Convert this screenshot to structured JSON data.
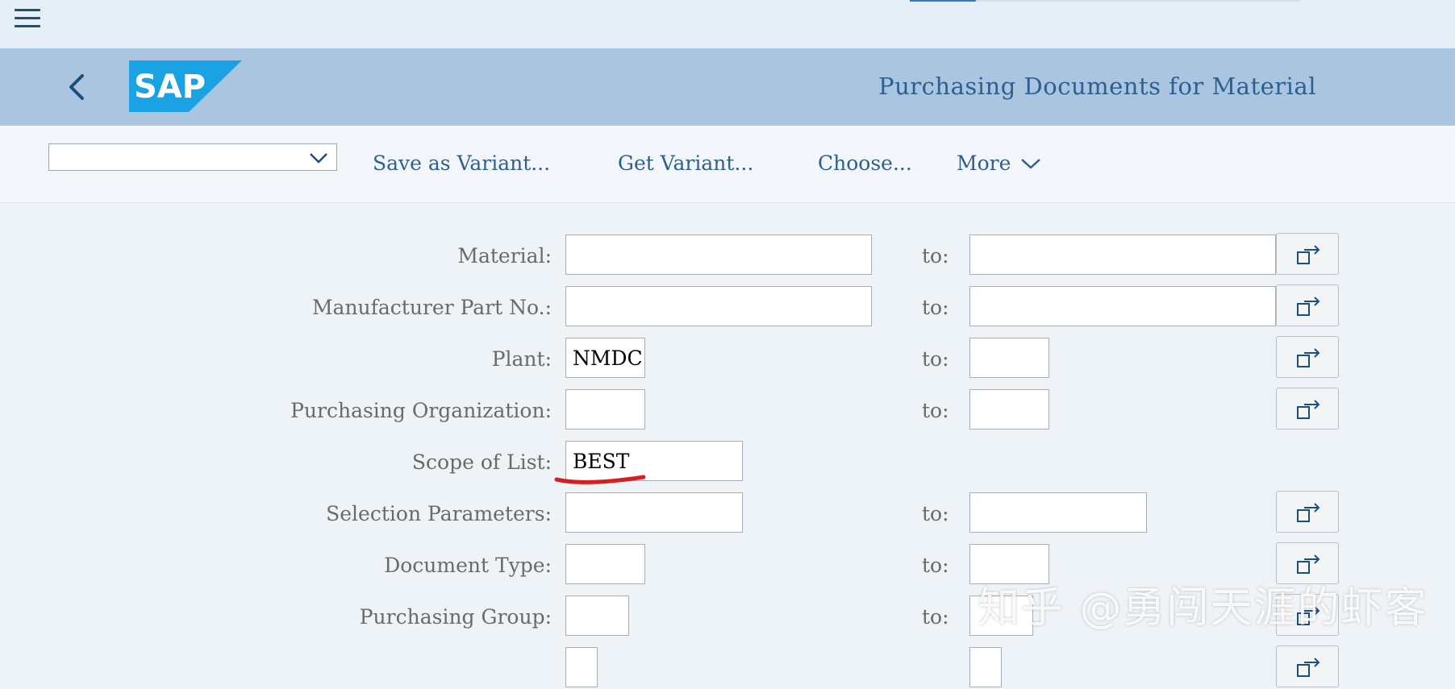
{
  "header": {
    "title": "Purchasing Documents for Material",
    "logo_text": "SAP",
    "loading_progress": 0.17
  },
  "toolbar": {
    "variant_value": "",
    "save_as_variant": "Save as Variant...",
    "get_variant": "Get Variant...",
    "choose": "Choose...",
    "more": "More"
  },
  "form": {
    "to_label": "to:",
    "fields": [
      {
        "label": "Material:",
        "from": "",
        "to": ""
      },
      {
        "label": "Manufacturer Part No.:",
        "from": "",
        "to": ""
      },
      {
        "label": "Plant:",
        "from": "NMDC",
        "to": ""
      },
      {
        "label": "Purchasing Organization:",
        "from": "",
        "to": ""
      },
      {
        "label": "Scope of List:",
        "from": "BEST"
      },
      {
        "label": "Selection Parameters:",
        "from": "",
        "to": ""
      },
      {
        "label": "Document Type:",
        "from": "",
        "to": ""
      },
      {
        "label": "Purchasing Group:",
        "from": "",
        "to": ""
      }
    ]
  },
  "watermark": "知乎 @勇闯天涯的虾客",
  "colors": {
    "shell": "#a9c5e0",
    "accent": "#2f5f8f",
    "annotation": "#d42020"
  }
}
